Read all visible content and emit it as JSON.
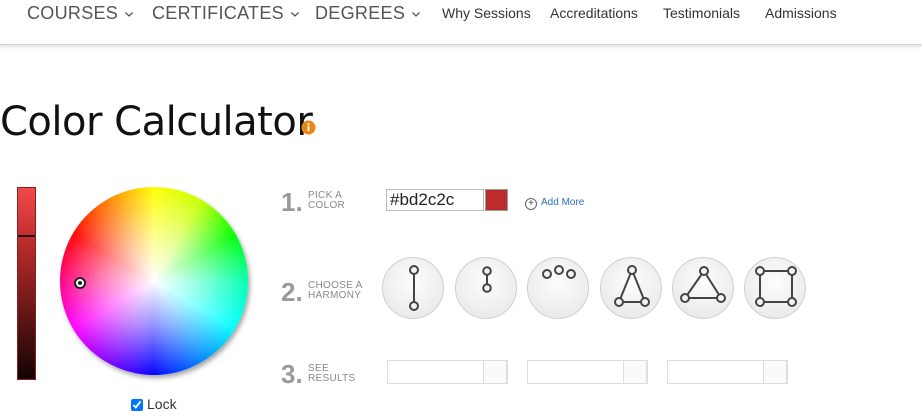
{
  "nav": {
    "items": [
      {
        "label": "COURSES",
        "dropdown": true
      },
      {
        "label": "CERTIFICATES",
        "dropdown": true
      },
      {
        "label": "DEGREES",
        "dropdown": true
      },
      {
        "label": "Why Sessions",
        "dropdown": false
      },
      {
        "label": "Accreditations",
        "dropdown": false
      },
      {
        "label": "Testimonials",
        "dropdown": false
      },
      {
        "label": "Admissions",
        "dropdown": false
      }
    ]
  },
  "page": {
    "title": "Color Calculator",
    "info_icon": "info-icon"
  },
  "picker": {
    "selected_color": "#bd2c2c",
    "lock_label": "Lock",
    "lock_checked": true
  },
  "steps": [
    {
      "number": "1.",
      "label_line1": "PICK A",
      "label_line2": "COLOR"
    },
    {
      "number": "2.",
      "label_line1": "CHOOSE A",
      "label_line2": "HARMONY"
    },
    {
      "number": "3.",
      "label_line1": "SEE",
      "label_line2": "RESULTS"
    }
  ],
  "color_input": {
    "value": "#bd2c2c",
    "add_more_label": "Add More"
  },
  "harmonies": [
    {
      "icon": "complementary-icon"
    },
    {
      "icon": "split-complementary-icon"
    },
    {
      "icon": "analogous-icon"
    },
    {
      "icon": "triad-icon"
    },
    {
      "icon": "triad-wide-icon"
    },
    {
      "icon": "square-icon"
    }
  ],
  "colors": {
    "accent": "#bd2c2c",
    "link": "#2a6fb7",
    "info": "#e8861a",
    "step_number": "#9a9a9a"
  }
}
